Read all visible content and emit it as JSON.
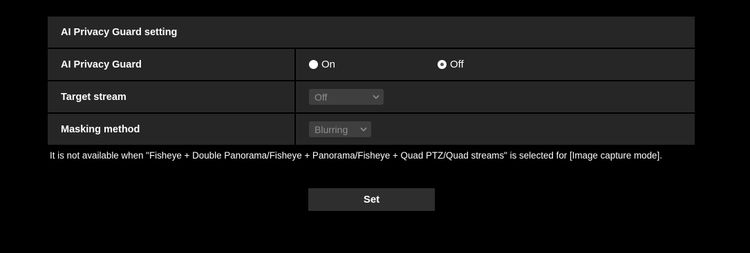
{
  "panel": {
    "title": "AI Privacy Guard setting"
  },
  "rows": {
    "ai_privacy_guard": {
      "label": "AI Privacy Guard",
      "options": [
        {
          "label": "On",
          "selected": false
        },
        {
          "label": "Off",
          "selected": true
        }
      ]
    },
    "target_stream": {
      "label": "Target stream",
      "selected_value": "Off",
      "disabled": true
    },
    "masking_method": {
      "label": "Masking method",
      "selected_value": "Blurring",
      "disabled": true
    }
  },
  "note": "It is not available when \"Fisheye + Double Panorama/Fisheye + Panorama/Fisheye + Quad PTZ/Quad streams\" is selected for [Image capture mode].",
  "set_button_label": "Set",
  "icons": {
    "select_arrow": "chevron-down-icon",
    "radio_on": "radio-unselected-icon",
    "radio_off": "radio-selected-icon"
  },
  "colors": {
    "background": "#000000",
    "panel": "#262626",
    "disabled_select_bg": "#3f3f3f",
    "disabled_text": "#8e8e8e",
    "button_bg": "#2e2e2e"
  }
}
